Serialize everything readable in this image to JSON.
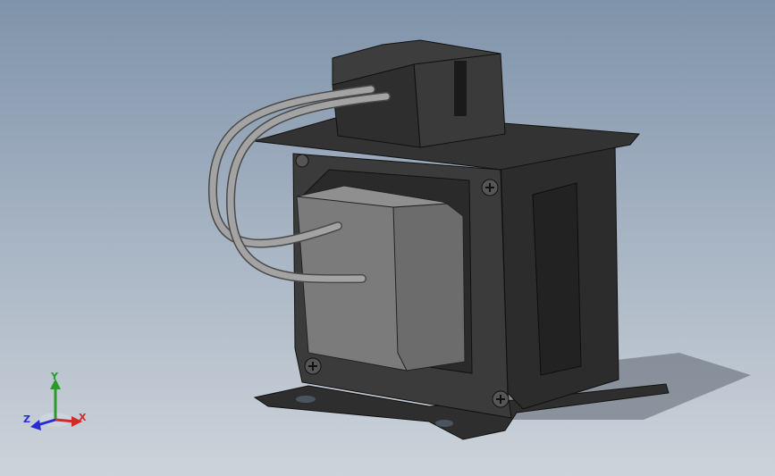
{
  "viewport": {
    "background_top": "#7f93aa",
    "background_bottom": "#cdd3da"
  },
  "model": {
    "name": "transformer",
    "body_color": "#3b3b3b",
    "coil_color": "#7a7a7a",
    "lead_wire_color": "#a0a0a0"
  },
  "triad": {
    "x_label": "X",
    "y_label": "Y",
    "z_label": "Z",
    "x_color": "#d42a2a",
    "y_color": "#2a9a2a",
    "z_color": "#2a2ad4"
  }
}
